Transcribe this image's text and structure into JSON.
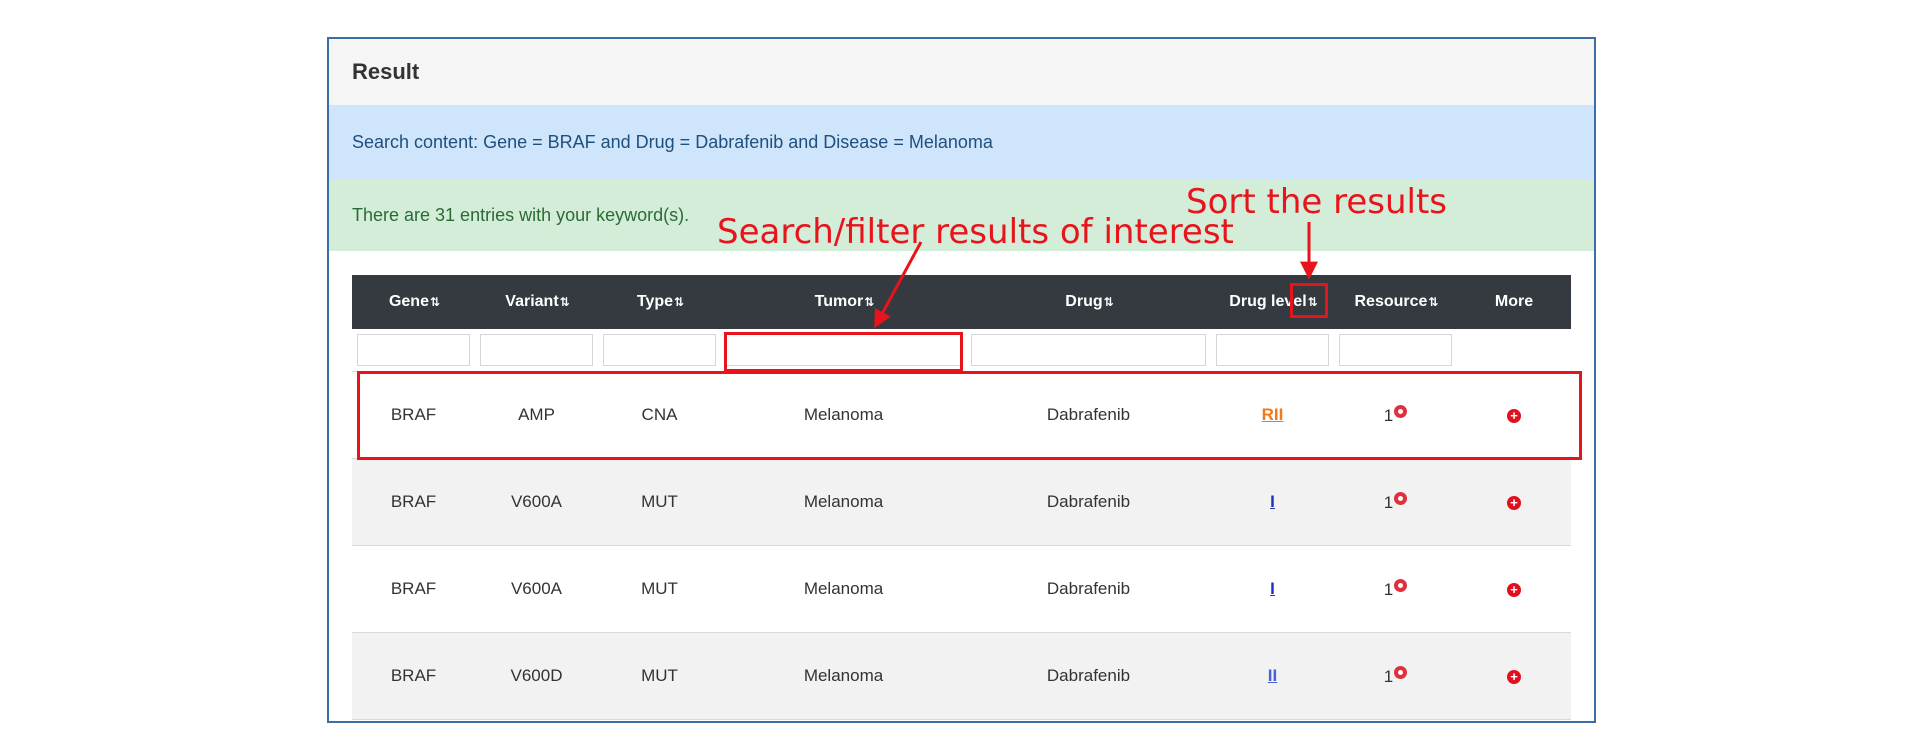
{
  "panel": {
    "title": "Result"
  },
  "search_content": "Search content: Gene = BRAF and Drug = Dabrafenib and Disease = Melanoma",
  "entries_text": "There are 31 entries with your keyword(s).",
  "table": {
    "columns": [
      "Gene",
      "Variant",
      "Type",
      "Tumor",
      "Drug",
      "Drug level",
      "Resource",
      "More"
    ],
    "sort_glyph": "⇅",
    "rows": [
      {
        "gene": "BRAF",
        "variant": "AMP",
        "type": "CNA",
        "tumor": "Melanoma",
        "drug": "Dabrafenib",
        "level": "RII",
        "level_color": "#f07a1a",
        "resource": "1"
      },
      {
        "gene": "BRAF",
        "variant": "V600A",
        "type": "MUT",
        "tumor": "Melanoma",
        "drug": "Dabrafenib",
        "level": "I",
        "level_color": "#2030c0",
        "resource": "1"
      },
      {
        "gene": "BRAF",
        "variant": "V600A",
        "type": "MUT",
        "tumor": "Melanoma",
        "drug": "Dabrafenib",
        "level": "I",
        "level_color": "#2030c0",
        "resource": "1"
      },
      {
        "gene": "BRAF",
        "variant": "V600D",
        "type": "MUT",
        "tumor": "Melanoma",
        "drug": "Dabrafenib",
        "level": "II",
        "level_color": "#4a60d8",
        "resource": "1"
      }
    ]
  },
  "annotations": {
    "sort_label": "Sort the results",
    "filter_label": "Search/filter results of interest",
    "color": "#e8141c"
  },
  "icons": {
    "resource_icon": "eye-icon",
    "more_icon": "plus-circle-icon"
  }
}
